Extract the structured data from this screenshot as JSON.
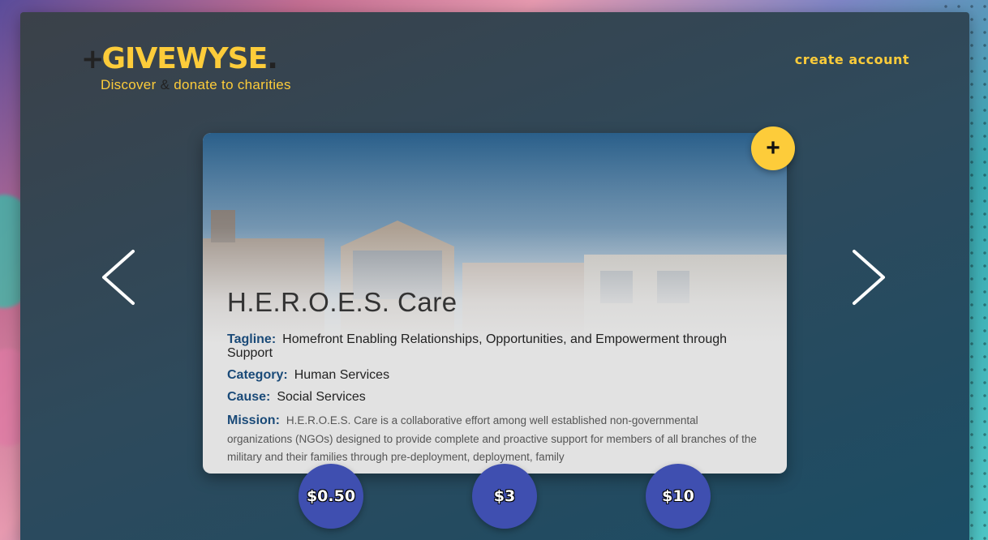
{
  "brand": {
    "logo_plus": "+",
    "logo_text": "GIVEWYSE",
    "logo_dot": ".",
    "tagline_part1": "Discover",
    "tagline_amp": "&",
    "tagline_part2": "donate to charities",
    "accent_color": "#fdcc3a"
  },
  "header": {
    "create_account_label": "create account"
  },
  "nav": {
    "prev_icon": "chevron-left-icon",
    "next_icon": "chevron-right-icon"
  },
  "charity": {
    "name": "H.E.R.O.E.S. Care",
    "tagline_label": "Tagline:",
    "tagline": "Homefront Enabling Relationships, Opportunities, and Empowerment through Support",
    "category_label": "Category:",
    "category": "Human Services",
    "cause_label": "Cause:",
    "cause": "Social Services",
    "mission_label": "Mission:",
    "mission": "H.E.R.O.E.S. Care is a collaborative effort among well established non-governmental organizations (NGOs) designed to provide complete and proactive support for members of all branches of the military and their families through pre-deployment, deployment, family"
  },
  "favorite_button": {
    "label": "+",
    "icon": "plus-icon"
  },
  "donations": [
    {
      "label": "$0.50"
    },
    {
      "label": "$3"
    },
    {
      "label": "$10"
    }
  ]
}
